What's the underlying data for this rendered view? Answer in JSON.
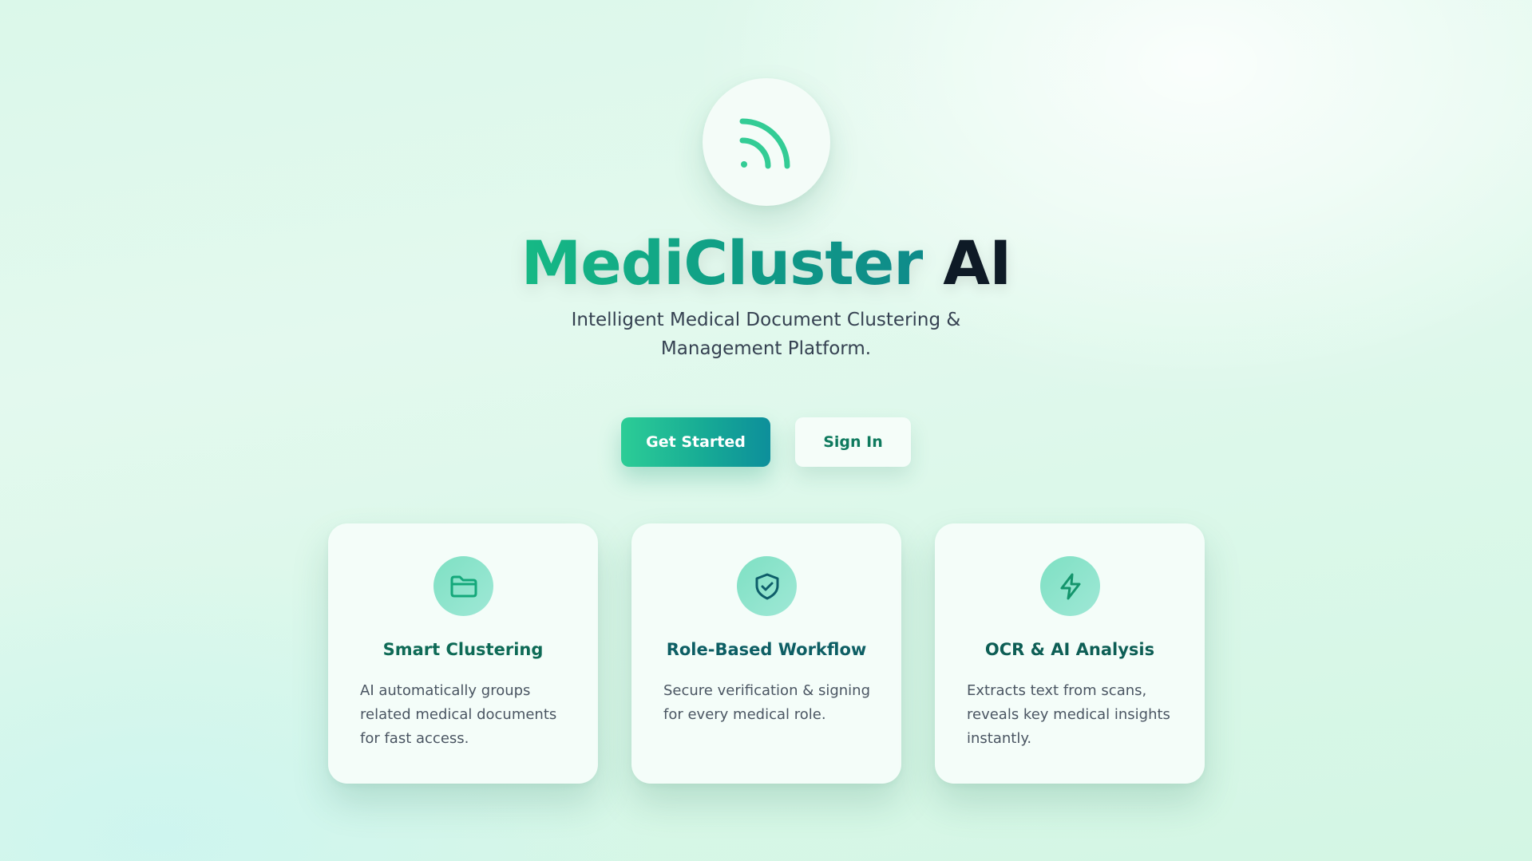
{
  "brand": {
    "logo_icon": "rss-signal-icon",
    "title_part1": "MediCluster",
    "title_part2": "AI",
    "subtitle_line1": "Intelligent Medical Document Clustering &",
    "subtitle_line2": "Management Platform.",
    "accent_color": "#1cb889",
    "dark_color": "#0e1a26"
  },
  "actions": {
    "get_started_label": "Get Started",
    "sign_in_label": "Sign In"
  },
  "features": [
    {
      "icon": "folder-icon",
      "title": "Smart Clustering",
      "desc_lines": [
        "AI automatically groups",
        "related medical documents",
        "for fast access."
      ]
    },
    {
      "icon": "shield-check-icon",
      "title": "Role-Based Workflow",
      "desc_lines": [
        "Secure verification & signing",
        "for every medical role."
      ]
    },
    {
      "icon": "lightning-icon",
      "title": "OCR & AI Analysis",
      "desc_lines": [
        "Extracts text from scans,",
        "reveals key medical insights",
        "instantly."
      ]
    }
  ]
}
